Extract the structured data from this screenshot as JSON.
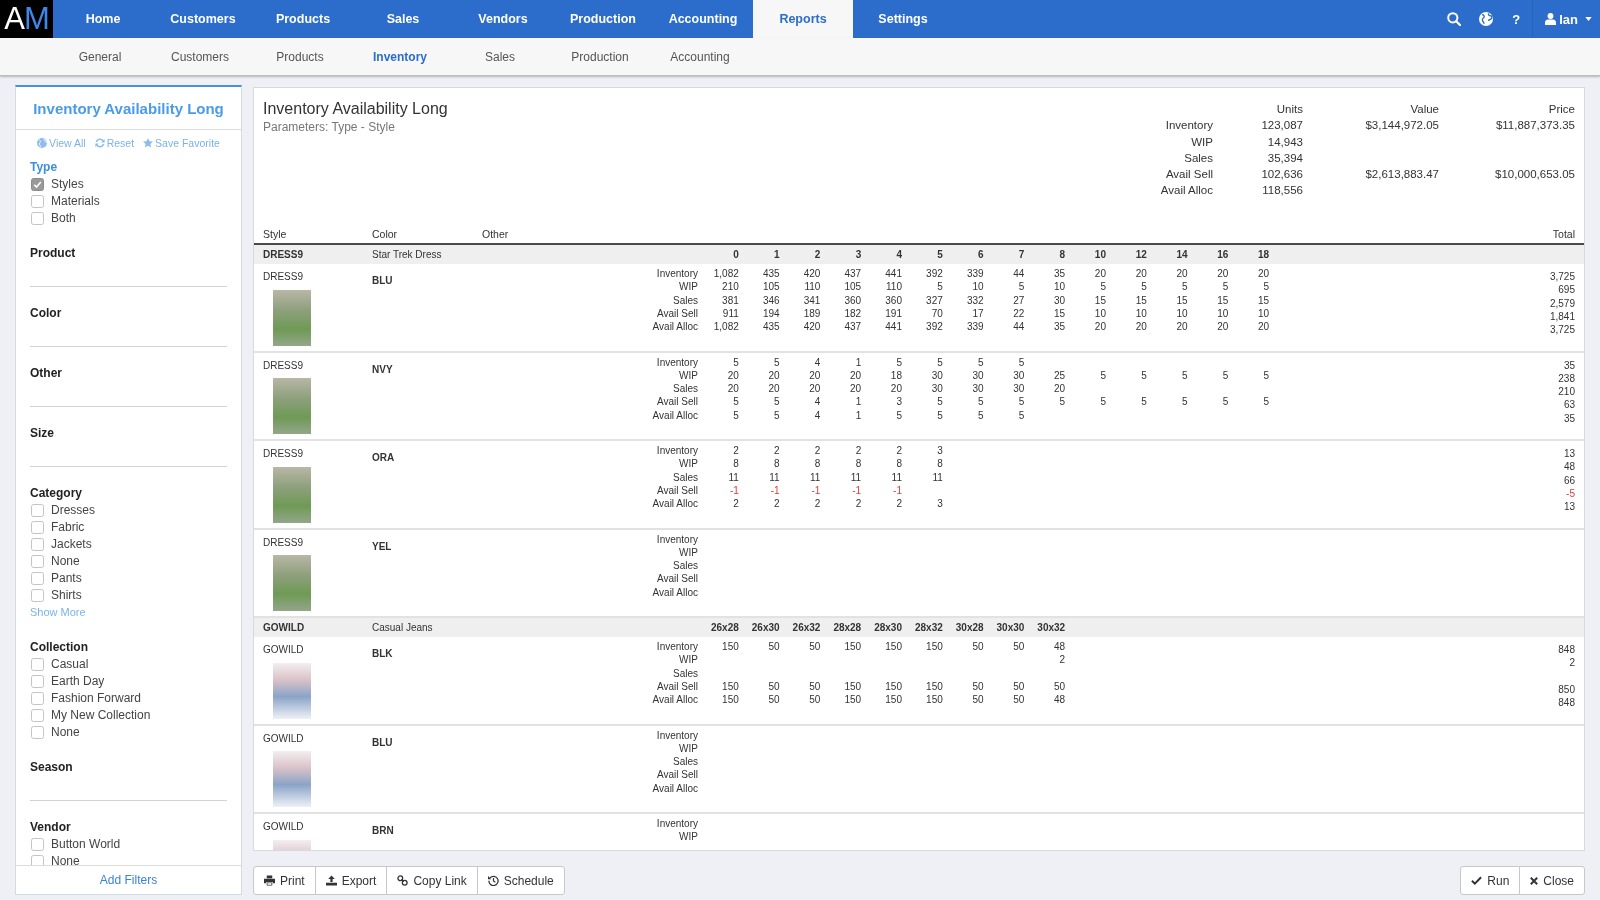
{
  "nav": {
    "logo": "AM",
    "items": [
      {
        "label": "Home",
        "selected": false
      },
      {
        "label": "Customers",
        "selected": false
      },
      {
        "label": "Products",
        "selected": false
      },
      {
        "label": "Sales",
        "selected": false
      },
      {
        "label": "Vendors",
        "selected": false
      },
      {
        "label": "Production",
        "selected": false
      },
      {
        "label": "Accounting",
        "selected": false
      },
      {
        "label": "Reports",
        "selected": true
      },
      {
        "label": "Settings",
        "selected": false
      }
    ],
    "help": "?",
    "user": "Ian"
  },
  "subnav": [
    {
      "label": "General",
      "selected": false
    },
    {
      "label": "Customers",
      "selected": false
    },
    {
      "label": "Products",
      "selected": false
    },
    {
      "label": "Inventory",
      "selected": true
    },
    {
      "label": "Sales",
      "selected": false
    },
    {
      "label": "Production",
      "selected": false
    },
    {
      "label": "Accounting",
      "selected": false
    }
  ],
  "sidebar": {
    "title": "Inventory Availability Long",
    "actions": [
      "View All",
      "Reset",
      "Save Favorite"
    ],
    "sections": [
      {
        "label": "Type",
        "kind": "checklist",
        "highlighted": true,
        "options": [
          {
            "label": "Styles",
            "checked": true
          },
          {
            "label": "Materials",
            "checked": false
          },
          {
            "label": "Both",
            "checked": false
          }
        ]
      },
      {
        "label": "Product",
        "kind": "field",
        "highlighted": false
      },
      {
        "label": "Color",
        "kind": "field",
        "highlighted": false
      },
      {
        "label": "Other",
        "kind": "field",
        "highlighted": false
      },
      {
        "label": "Size",
        "kind": "field",
        "highlighted": false
      },
      {
        "label": "Category",
        "kind": "checklist",
        "highlighted": false,
        "options": [
          {
            "label": "Dresses",
            "checked": false
          },
          {
            "label": "Fabric",
            "checked": false
          },
          {
            "label": "Jackets",
            "checked": false
          },
          {
            "label": "None",
            "checked": false
          },
          {
            "label": "Pants",
            "checked": false
          },
          {
            "label": "Shirts",
            "checked": false
          }
        ],
        "more_link": "Show More"
      },
      {
        "label": "Collection",
        "kind": "checklist",
        "highlighted": false,
        "options": [
          {
            "label": "Casual",
            "checked": false
          },
          {
            "label": "Earth Day",
            "checked": false
          },
          {
            "label": "Fashion Forward",
            "checked": false
          },
          {
            "label": "My New Collection",
            "checked": false
          },
          {
            "label": "None",
            "checked": false
          }
        ]
      },
      {
        "label": "Season",
        "kind": "field",
        "highlighted": false
      },
      {
        "label": "Vendor",
        "kind": "checklist",
        "highlighted": false,
        "options": [
          {
            "label": "Button World",
            "checked": false
          },
          {
            "label": "None",
            "checked": false
          }
        ]
      }
    ],
    "footer": "Add Filters"
  },
  "report": {
    "title": "Inventory Availability Long",
    "parameters": "Parameters: Type - Style",
    "summary": {
      "columns": [
        "Units",
        "Value",
        "Price"
      ],
      "rows": [
        {
          "label": "Inventory",
          "units": "123,087",
          "value": "$3,144,972.05",
          "price": "$11,887,373.35"
        },
        {
          "label": "WIP",
          "units": "14,943"
        },
        {
          "label": "Sales",
          "units": "35,394"
        },
        {
          "label": "Avail Sell",
          "units": "102,636",
          "value": "$2,613,883.47",
          "price": "$10,000,653.05"
        },
        {
          "label": "Avail Alloc",
          "units": "118,556"
        }
      ]
    },
    "columns": {
      "style_heading": "Style",
      "color_heading": "Color",
      "other_heading": "Other",
      "total_heading": "Total"
    },
    "groups": [
      {
        "style": "DRESS9",
        "description": "Star Trek Dress",
        "sizes": [
          "0",
          "1",
          "2",
          "3",
          "4",
          "5",
          "6",
          "7",
          "8",
          "10",
          "12",
          "14",
          "16",
          "18"
        ],
        "items": [
          {
            "style": "DRESS9",
            "color_code": "BLU",
            "metrics": [
              {
                "label": "Inventory",
                "total": "3,725",
                "alert": false
              },
              {
                "label": "WIP",
                "total": "695",
                "alert": false
              },
              {
                "label": "Sales",
                "total": "2,579",
                "alert": false
              },
              {
                "label": "Avail Sell",
                "total": "1,841",
                "alert": false
              },
              {
                "label": "Avail Alloc",
                "total": "3,725",
                "alert": false
              }
            ],
            "columns": [
              {
                "inventory": "1,082",
                "wip": "210",
                "sales": "381",
                "avail_sell": "911",
                "avail_alloc": "1,082"
              },
              {
                "inventory": "435",
                "wip": "105",
                "sales": "346",
                "avail_sell": "194",
                "avail_alloc": "435"
              },
              {
                "inventory": "420",
                "wip": "110",
                "sales": "341",
                "avail_sell": "189",
                "avail_alloc": "420"
              },
              {
                "inventory": "437",
                "wip": "105",
                "sales": "360",
                "avail_sell": "182",
                "avail_alloc": "437"
              },
              {
                "inventory": "441",
                "wip": "110",
                "sales": "360",
                "avail_sell": "191",
                "avail_alloc": "441"
              },
              {
                "inventory": "392",
                "wip": "5",
                "sales": "327",
                "avail_sell": "70",
                "avail_alloc": "392"
              },
              {
                "inventory": "339",
                "wip": "10",
                "sales": "332",
                "avail_sell": "17",
                "avail_alloc": "339"
              },
              {
                "inventory": "44",
                "wip": "5",
                "sales": "27",
                "avail_sell": "22",
                "avail_alloc": "44"
              },
              {
                "inventory": "35",
                "wip": "10",
                "sales": "30",
                "avail_sell": "15",
                "avail_alloc": "35"
              },
              {
                "inventory": "20",
                "wip": "5",
                "sales": "15",
                "avail_sell": "10",
                "avail_alloc": "20"
              },
              {
                "inventory": "20",
                "wip": "5",
                "sales": "15",
                "avail_sell": "10",
                "avail_alloc": "20"
              },
              {
                "inventory": "20",
                "wip": "5",
                "sales": "15",
                "avail_sell": "10",
                "avail_alloc": "20"
              },
              {
                "inventory": "20",
                "wip": "5",
                "sales": "15",
                "avail_sell": "10",
                "avail_alloc": "20"
              },
              {
                "inventory": "20",
                "wip": "5",
                "sales": "15",
                "avail_sell": "10",
                "avail_alloc": "20"
              }
            ]
          },
          {
            "style": "DRESS9",
            "color_code": "NVY",
            "metrics": [
              {
                "label": "Inventory",
                "total": "35",
                "alert": false
              },
              {
                "label": "WIP",
                "total": "238",
                "alert": false
              },
              {
                "label": "Sales",
                "total": "210",
                "alert": false
              },
              {
                "label": "Avail Sell",
                "total": "63",
                "alert": false
              },
              {
                "label": "Avail Alloc",
                "total": "35",
                "alert": false
              }
            ],
            "columns": [
              {
                "inventory": "5",
                "wip": "20",
                "sales": "20",
                "avail_sell": "5",
                "avail_alloc": "5"
              },
              {
                "inventory": "5",
                "wip": "20",
                "sales": "20",
                "avail_sell": "5",
                "avail_alloc": "5"
              },
              {
                "inventory": "4",
                "wip": "20",
                "sales": "20",
                "avail_sell": "4",
                "avail_alloc": "4"
              },
              {
                "inventory": "1",
                "wip": "20",
                "sales": "20",
                "avail_sell": "1",
                "avail_alloc": "1"
              },
              {
                "inventory": "5",
                "wip": "18",
                "sales": "20",
                "avail_sell": "3",
                "avail_alloc": "5"
              },
              {
                "inventory": "5",
                "wip": "30",
                "sales": "30",
                "avail_sell": "5",
                "avail_alloc": "5"
              },
              {
                "inventory": "5",
                "wip": "30",
                "sales": "30",
                "avail_sell": "5",
                "avail_alloc": "5"
              },
              {
                "inventory": "5",
                "wip": "30",
                "sales": "30",
                "avail_sell": "5",
                "avail_alloc": "5"
              },
              {
                "wip": "25",
                "sales": "20",
                "avail_sell": "5"
              },
              {
                "wip": "5",
                "avail_sell": "5"
              },
              {
                "wip": "5",
                "avail_sell": "5"
              },
              {
                "wip": "5",
                "avail_sell": "5"
              },
              {
                "wip": "5",
                "avail_sell": "5"
              },
              {
                "wip": "5",
                "avail_sell": "5"
              }
            ]
          },
          {
            "style": "DRESS9",
            "color_code": "ORA",
            "metrics": [
              {
                "label": "Inventory",
                "total": "13",
                "alert": false
              },
              {
                "label": "WIP",
                "total": "48",
                "alert": false
              },
              {
                "label": "Sales",
                "total": "66",
                "alert": false
              },
              {
                "label": "Avail Sell",
                "total": "-5",
                "alert": true
              },
              {
                "label": "Avail Alloc",
                "total": "13",
                "alert": false
              }
            ],
            "columns": [
              {
                "inventory": "2",
                "wip": "8",
                "sales": "11",
                "avail_sell": "-1",
                "avail_alloc": "2"
              },
              {
                "inventory": "2",
                "wip": "8",
                "sales": "11",
                "avail_sell": "-1",
                "avail_alloc": "2"
              },
              {
                "inventory": "2",
                "wip": "8",
                "sales": "11",
                "avail_sell": "-1",
                "avail_alloc": "2"
              },
              {
                "inventory": "2",
                "wip": "8",
                "sales": "11",
                "avail_sell": "-1",
                "avail_alloc": "2"
              },
              {
                "inventory": "2",
                "wip": "8",
                "sales": "11",
                "avail_sell": "-1",
                "avail_alloc": "2"
              },
              {
                "inventory": "3",
                "wip": "8",
                "sales": "11",
                "avail_alloc": "3"
              }
            ]
          },
          {
            "style": "DRESS9",
            "color_code": "YEL",
            "metrics": [
              {
                "label": "Inventory"
              },
              {
                "label": "WIP"
              },
              {
                "label": "Sales"
              },
              {
                "label": "Avail Sell"
              },
              {
                "label": "Avail Alloc"
              }
            ]
          }
        ]
      },
      {
        "style": "GOWILD",
        "description": "Casual Jeans",
        "sizes": [
          "26x28",
          "26x30",
          "26x32",
          "28x28",
          "28x30",
          "28x32",
          "30x28",
          "30x30",
          "30x32"
        ],
        "items": [
          {
            "style": "GOWILD",
            "color_code": "BLK",
            "metrics": [
              {
                "label": "Inventory",
                "total": "848",
                "alert": false
              },
              {
                "label": "WIP",
                "total": "2",
                "alert": false
              },
              {
                "label": "Sales"
              },
              {
                "label": "Avail Sell",
                "total": "850",
                "alert": false
              },
              {
                "label": "Avail Alloc",
                "total": "848",
                "alert": false
              }
            ],
            "columns": [
              {
                "inventory": "150",
                "avail_sell": "150",
                "avail_alloc": "150"
              },
              {
                "inventory": "50",
                "avail_sell": "50",
                "avail_alloc": "50"
              },
              {
                "inventory": "50",
                "avail_sell": "50",
                "avail_alloc": "50"
              },
              {
                "inventory": "150",
                "avail_sell": "150",
                "avail_alloc": "150"
              },
              {
                "inventory": "150",
                "avail_sell": "150",
                "avail_alloc": "150"
              },
              {
                "inventory": "150",
                "avail_sell": "150",
                "avail_alloc": "150"
              },
              {
                "inventory": "50",
                "avail_sell": "50",
                "avail_alloc": "50"
              },
              {
                "inventory": "50",
                "avail_sell": "50",
                "avail_alloc": "50"
              },
              {
                "inventory": "48",
                "wip": "2",
                "avail_sell": "50",
                "avail_alloc": "48"
              }
            ]
          },
          {
            "style": "GOWILD",
            "color_code": "BLU",
            "metrics": [
              {
                "label": "Inventory"
              },
              {
                "label": "WIP"
              },
              {
                "label": "Sales"
              },
              {
                "label": "Avail Sell"
              },
              {
                "label": "Avail Alloc"
              }
            ]
          },
          {
            "style": "GOWILD",
            "color_code": "BRN",
            "metrics": [
              {
                "label": "Inventory"
              },
              {
                "label": "WIP"
              }
            ]
          }
        ]
      }
    ]
  },
  "actions": [
    "Print",
    "Export",
    "Copy Link",
    "Schedule"
  ],
  "dialog_buttons": [
    "Run",
    "Close"
  ]
}
